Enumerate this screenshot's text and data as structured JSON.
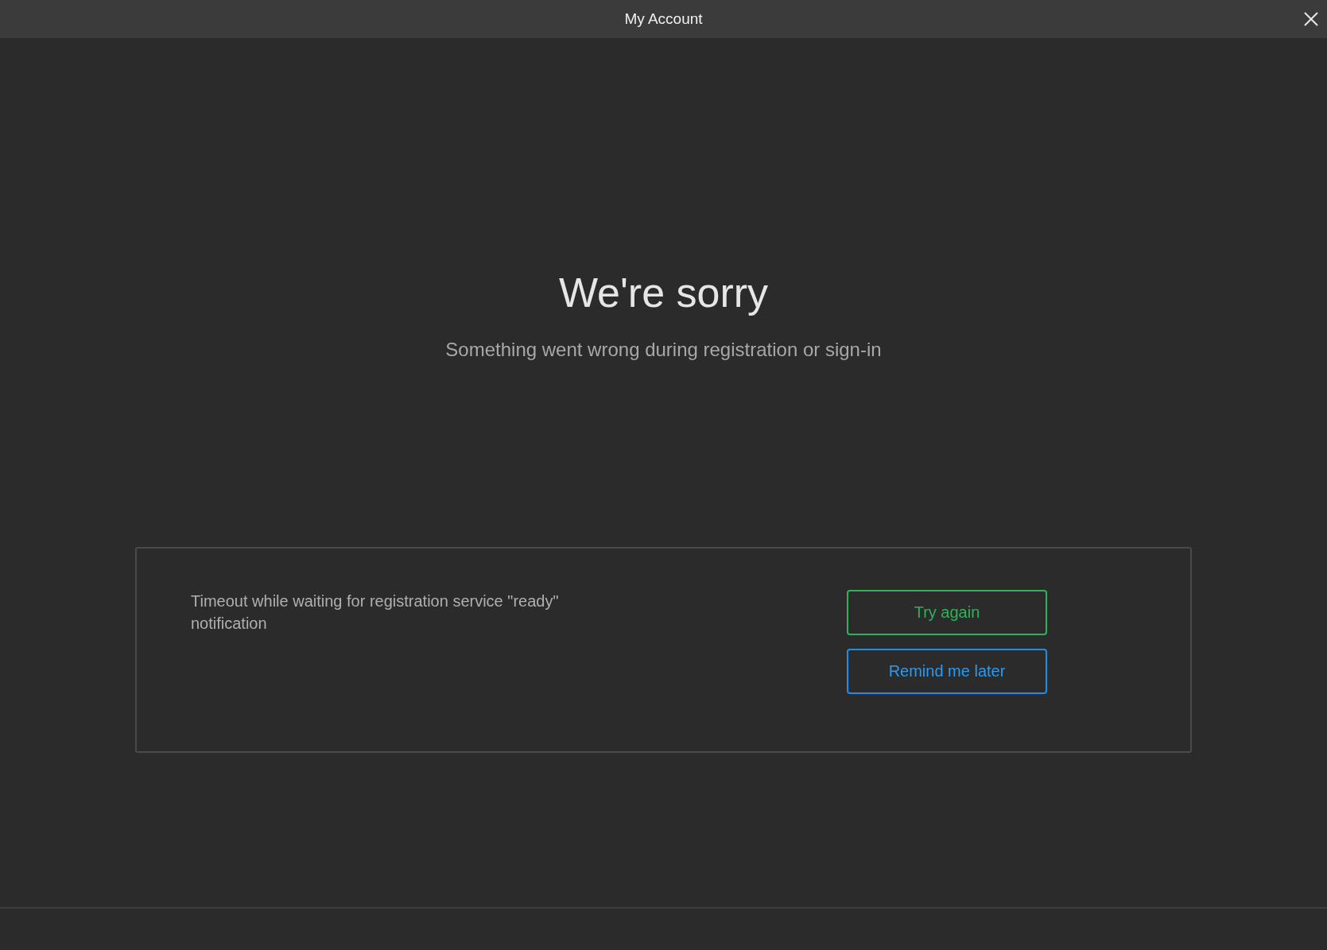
{
  "window": {
    "title": "My Account"
  },
  "heading": "We're sorry",
  "subtitle": "Something went wrong during registration or sign-in",
  "error_card": {
    "message": "Timeout while waiting for registration service \"ready\" notification",
    "buttons": [
      {
        "label": "Try again",
        "kind": "retry"
      },
      {
        "label": "Remind me later",
        "kind": "later"
      }
    ]
  }
}
